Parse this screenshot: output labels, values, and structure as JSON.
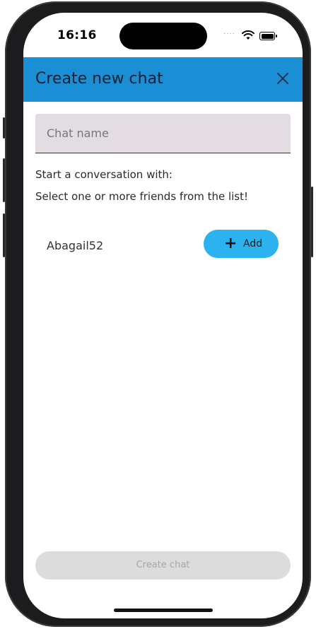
{
  "status_bar": {
    "time": "16:16",
    "signal": "····"
  },
  "app_bar": {
    "title": "Create new chat"
  },
  "form": {
    "chat_name_placeholder": "Chat name",
    "chat_name_value": ""
  },
  "labels": {
    "start_conversation": "Start a conversation with:",
    "select_friends": "Select one or more friends from the list!"
  },
  "friends": [
    {
      "name": "Abagail52",
      "add_icon": "+",
      "add_label": "Add"
    }
  ],
  "actions": {
    "create_chat_label": "Create chat"
  },
  "colors": {
    "app_bar": "#1a8fd6",
    "add_button": "#2db2f0",
    "field_bg": "#e3dde3",
    "create_disabled": "#dcdcdc"
  },
  "icons": {
    "close": "close-icon",
    "add": "plus-icon",
    "wifi": "wifi-icon",
    "battery": "battery-icon"
  }
}
